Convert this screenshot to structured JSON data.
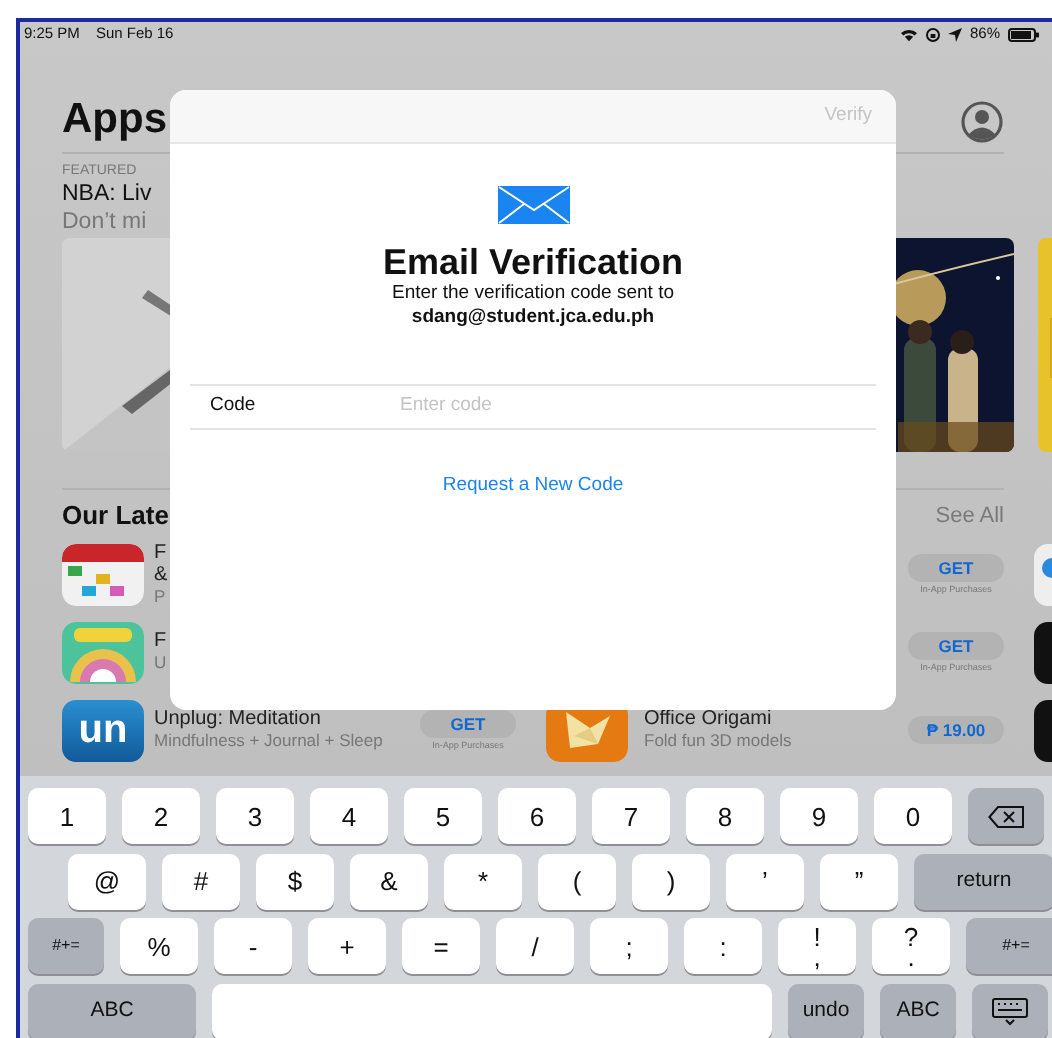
{
  "status_bar": {
    "time": "9:25 PM",
    "date": "Sun Feb 16",
    "battery": "86%"
  },
  "header": {
    "title": "Apps"
  },
  "featured": [
    {
      "label": "FEATURED",
      "title": "NBA: Liv",
      "subtitle": "Don’t mi",
      "kind": "picture"
    },
    {
      "kind": "picture"
    },
    {
      "kind": "picture"
    }
  ],
  "latest": {
    "title": "Our Late",
    "see_all": "See All",
    "rows": [
      {
        "left": {
          "kind": "calendar",
          "title": "F",
          "title_2": "&",
          "subtitle": "P"
        },
        "right": {
          "button": "GET",
          "note": "In-App Purchases"
        }
      },
      {
        "left": {
          "kind": "ball",
          "title": "F",
          "subtitle": "U"
        },
        "right": {
          "button": "GET",
          "note": "In-App Purchases"
        }
      },
      {
        "left": {
          "kind": "logo",
          "icon_text": "un",
          "title": "Unplug: Meditation",
          "subtitle": "Mindfulness + Journal + Sleep",
          "button": "GET",
          "note": "In-App Purchases"
        },
        "right": {
          "kind": "origami",
          "title": "Office Origami",
          "subtitle": "Fold fun 3D models",
          "button": "₱ 19.00"
        }
      }
    ]
  },
  "dialog": {
    "action": "Verify",
    "action_disabled": true,
    "title": "Email Verification",
    "message": "Enter the verification code sent to",
    "email": "sdang@student.jca.edu.ph",
    "field_label": "Code",
    "placeholder": "Enter code",
    "link": "Request a New Code"
  },
  "keyboard": [
    [
      {
        "kind": "char",
        "label": "1"
      },
      {
        "kind": "char",
        "label": "2"
      },
      {
        "kind": "char",
        "label": "3"
      },
      {
        "kind": "char",
        "label": "4"
      },
      {
        "kind": "char",
        "label": "5"
      },
      {
        "kind": "char",
        "label": "6"
      },
      {
        "kind": "char",
        "label": "7"
      },
      {
        "kind": "char",
        "label": "8"
      },
      {
        "kind": "char",
        "label": "9"
      },
      {
        "kind": "char",
        "label": "0"
      },
      {
        "kind": "delete"
      }
    ],
    [
      {
        "kind": "char",
        "label": "@"
      },
      {
        "kind": "char",
        "label": "#"
      },
      {
        "kind": "char",
        "label": "$"
      },
      {
        "kind": "char",
        "label": "&"
      },
      {
        "kind": "char",
        "label": "*"
      },
      {
        "kind": "char",
        "label": "("
      },
      {
        "kind": "char",
        "label": ")"
      },
      {
        "kind": "char",
        "label": "’"
      },
      {
        "kind": "char",
        "label": "”"
      },
      {
        "kind": "return",
        "label": "return"
      }
    ],
    [
      {
        "kind": "shift",
        "label": "#+="
      },
      {
        "kind": "char",
        "label": "%"
      },
      {
        "kind": "char",
        "label": "-"
      },
      {
        "kind": "char",
        "label": "+"
      },
      {
        "kind": "char",
        "label": "="
      },
      {
        "kind": "char",
        "label": "/"
      },
      {
        "kind": "char",
        "label": ";"
      },
      {
        "kind": "char",
        "label": ":"
      },
      {
        "kind": "char",
        "label": "!",
        "sub": ","
      },
      {
        "kind": "char",
        "label": "?",
        "sub": "."
      },
      {
        "kind": "shift",
        "label": "#+="
      }
    ],
    [
      {
        "kind": "mode-wide",
        "label": "ABC"
      },
      {
        "kind": "space"
      },
      {
        "kind": "fn",
        "label": "undo"
      },
      {
        "kind": "fn",
        "label": "ABC"
      },
      {
        "kind": "hide"
      }
    ]
  ]
}
